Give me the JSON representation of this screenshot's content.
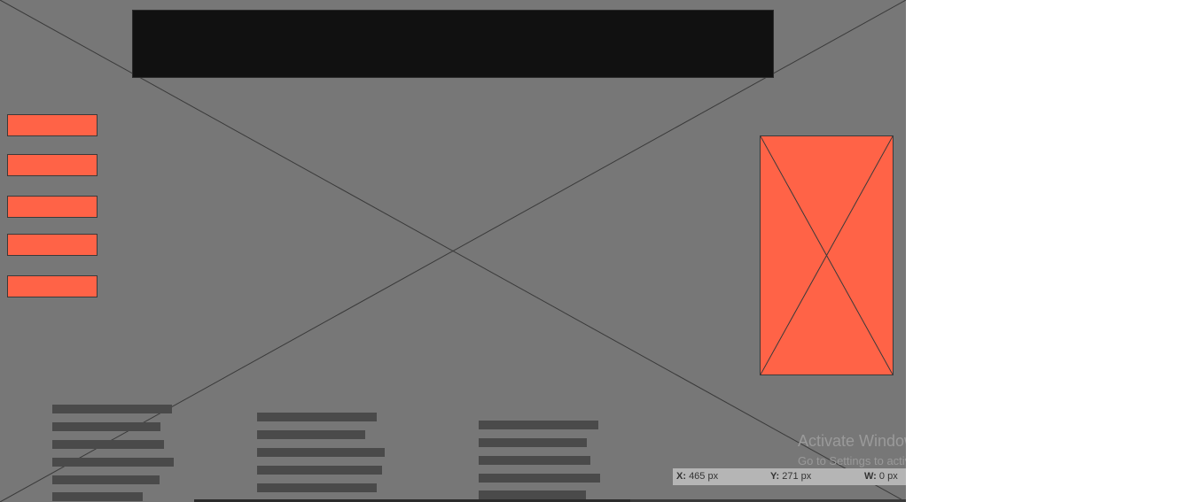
{
  "colors": {
    "canvas_background": "#777777",
    "header_block": "#111111",
    "accent": "#ff6347",
    "text_line_placeholder": "#4a4a4a",
    "status_bar": "#b5b5b5",
    "watermark_text": "#9a9a9a"
  },
  "wireframe": {
    "nav_buttons_count": 5,
    "text_columns": [
      {
        "lines": 6
      },
      {
        "lines": 5
      },
      {
        "lines": 5
      }
    ]
  },
  "watermark": {
    "title": "Activate Windows",
    "subtitle": "Go to Settings to activate Windows."
  },
  "status_bar": {
    "x_label": "X:",
    "x_value": "465 px",
    "y_label": "Y:",
    "y_value": "271 px",
    "w_label": "W:",
    "w_value": "0 px"
  }
}
